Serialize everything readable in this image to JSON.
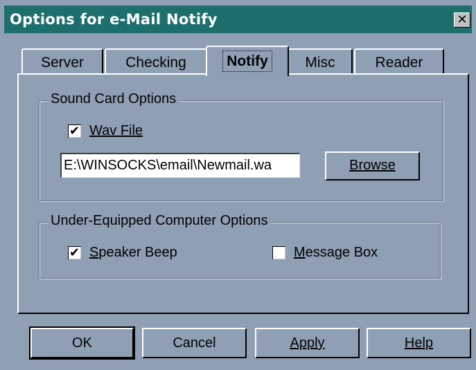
{
  "window": {
    "title": "Options for e-Mail Notify",
    "close_glyph": "✕"
  },
  "tabs": [
    {
      "label": "Server"
    },
    {
      "label": "Checking"
    },
    {
      "label": "Notify"
    },
    {
      "label": "Misc"
    },
    {
      "label": "Reader"
    }
  ],
  "sound_card": {
    "group_label": "Sound Card Options",
    "wav_label": "Wav File",
    "wav_checked": "✔",
    "path_value": "E:\\WINSOCKS\\email\\Newmail.wa",
    "browse_label": "Browse"
  },
  "under_equipped": {
    "group_label": "Under-Equipped Computer Options",
    "speaker_label": "Speaker Beep",
    "speaker_checked": "✔",
    "message_label": "Message Box",
    "message_checked": ""
  },
  "buttons": {
    "ok": "OK",
    "cancel": "Cancel",
    "apply": "Apply",
    "help": "Help"
  }
}
